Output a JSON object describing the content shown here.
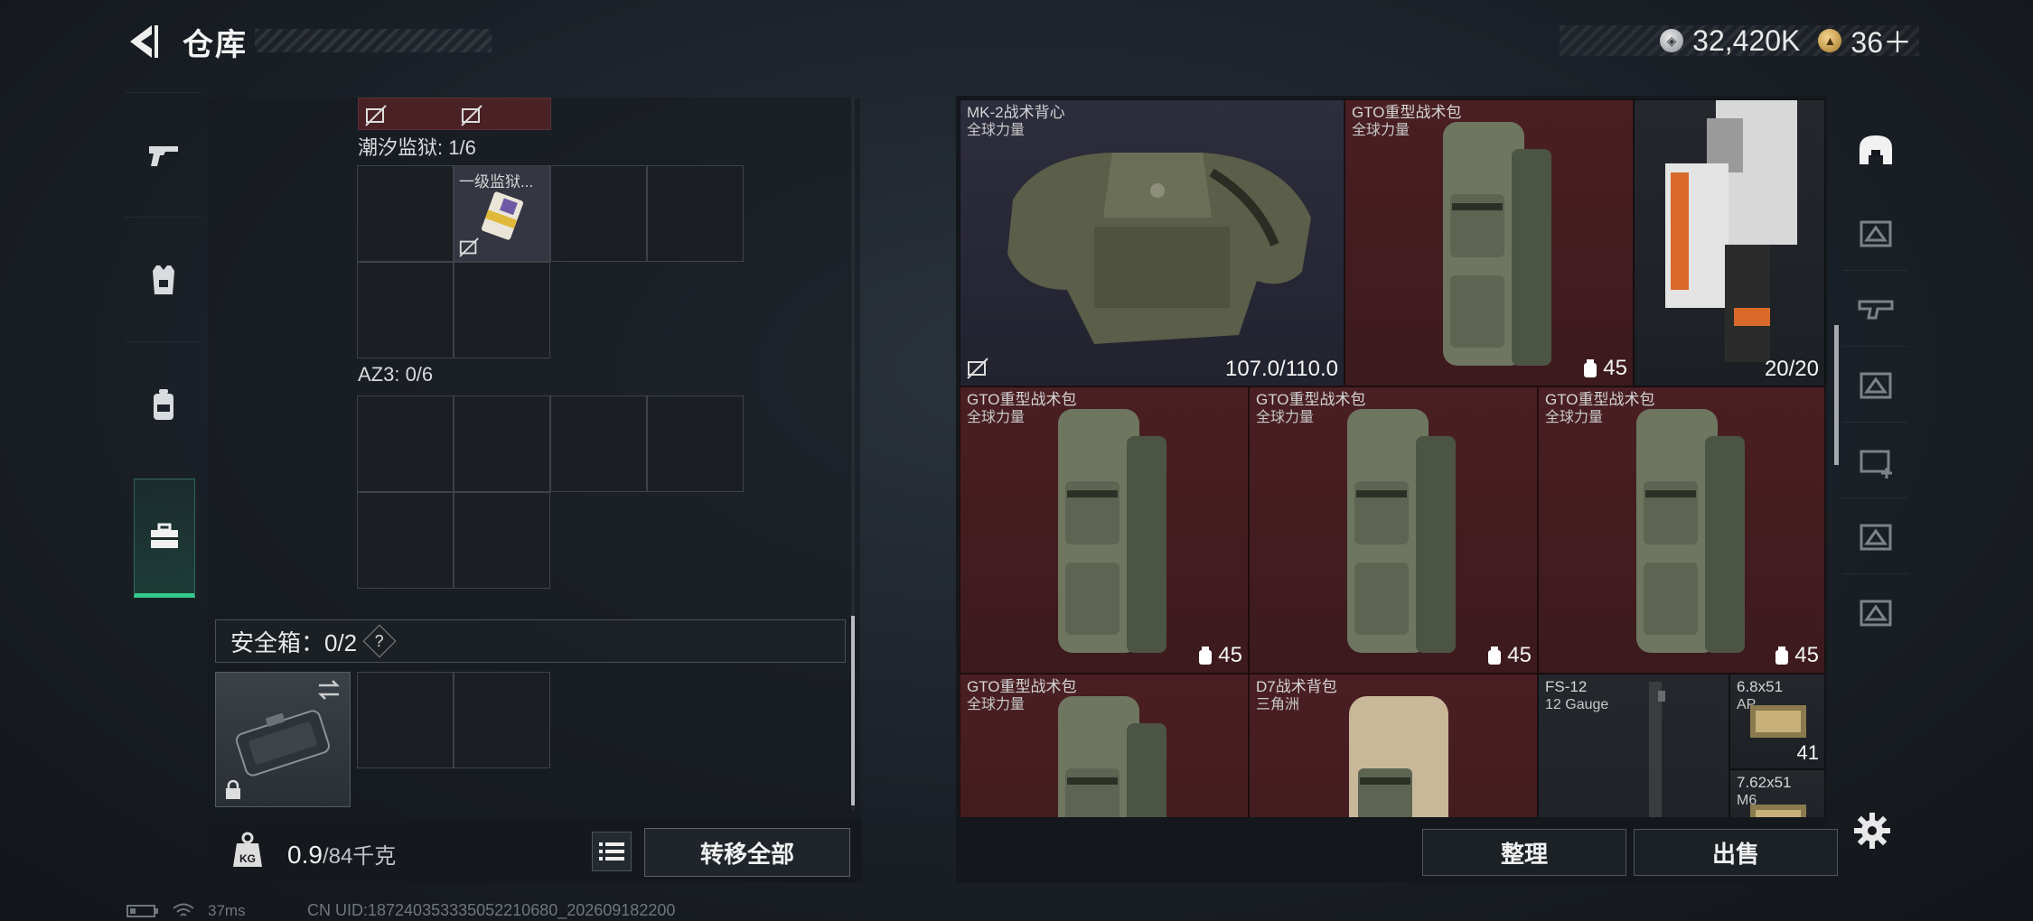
{
  "header": {
    "title": "仓库",
    "currency": {
      "silver": "32,420K",
      "gold": "36＋"
    }
  },
  "left_tabs": [
    {
      "icon": "pistol-icon",
      "active": false
    },
    {
      "icon": "armor-vest-icon",
      "active": false
    },
    {
      "icon": "backpack-icon",
      "active": false
    },
    {
      "icon": "briefcase-icon",
      "active": true
    }
  ],
  "containers": {
    "section1": {
      "label": "潮汐监狱: 1/6",
      "item_name": "一级监狱..."
    },
    "section2": {
      "label": "AZ3: 0/6"
    },
    "safe_box": {
      "label": "安全箱：0/2",
      "help": "?"
    }
  },
  "weight": {
    "current": "0.9",
    "max": "/84千克",
    "icon_label": "KG"
  },
  "buttons": {
    "transfer_all": "转移全部",
    "sort": "整理",
    "sell": "出售"
  },
  "warehouse_items": [
    {
      "name": "MK-2战术背心",
      "sub": "全球力量",
      "value": "107.0/110.0",
      "color": "purple"
    },
    {
      "name": "GTO重型战术包",
      "sub": "全球力量",
      "value": "45",
      "color": "red"
    },
    {
      "name": "",
      "sub": "",
      "value": "20/20",
      "color": "dark"
    },
    {
      "name": "GTO重型战术包",
      "sub": "全球力量",
      "value": "45",
      "color": "red"
    },
    {
      "name": "GTO重型战术包",
      "sub": "全球力量",
      "value": "45",
      "color": "red"
    },
    {
      "name": "GTO重型战术包",
      "sub": "全球力量",
      "value": "45",
      "color": "red"
    },
    {
      "name": "GTO重型战术包",
      "sub": "全球力量",
      "value": "",
      "color": "red"
    },
    {
      "name": "D7战术背包",
      "sub": "三角洲",
      "value": "",
      "color": "red"
    },
    {
      "name": "FS-12",
      "sub": "12 Gauge",
      "value": "",
      "color": "dark"
    },
    {
      "name": "6.8x51",
      "sub": "AP",
      "value": "41",
      "color": "dark"
    },
    {
      "name": "7.62x51",
      "sub": "M6",
      "value": "",
      "color": "dark"
    }
  ],
  "type_tabs": [
    "helmet-icon",
    "ammo-tier3-icon",
    "weapon-tier3-icon",
    "armor-tier3-icon",
    "medkit-tier4-icon",
    "ammo-tier3-alt-icon",
    "grenade-tier3-icon"
  ],
  "status": {
    "ping": "37ms",
    "uid": "CN UID:18724035333505221068​0_202609182200"
  },
  "colors": {
    "accent": "#35c98e",
    "red_bg": "#4a1f23",
    "panel_bg": "#14181c"
  }
}
